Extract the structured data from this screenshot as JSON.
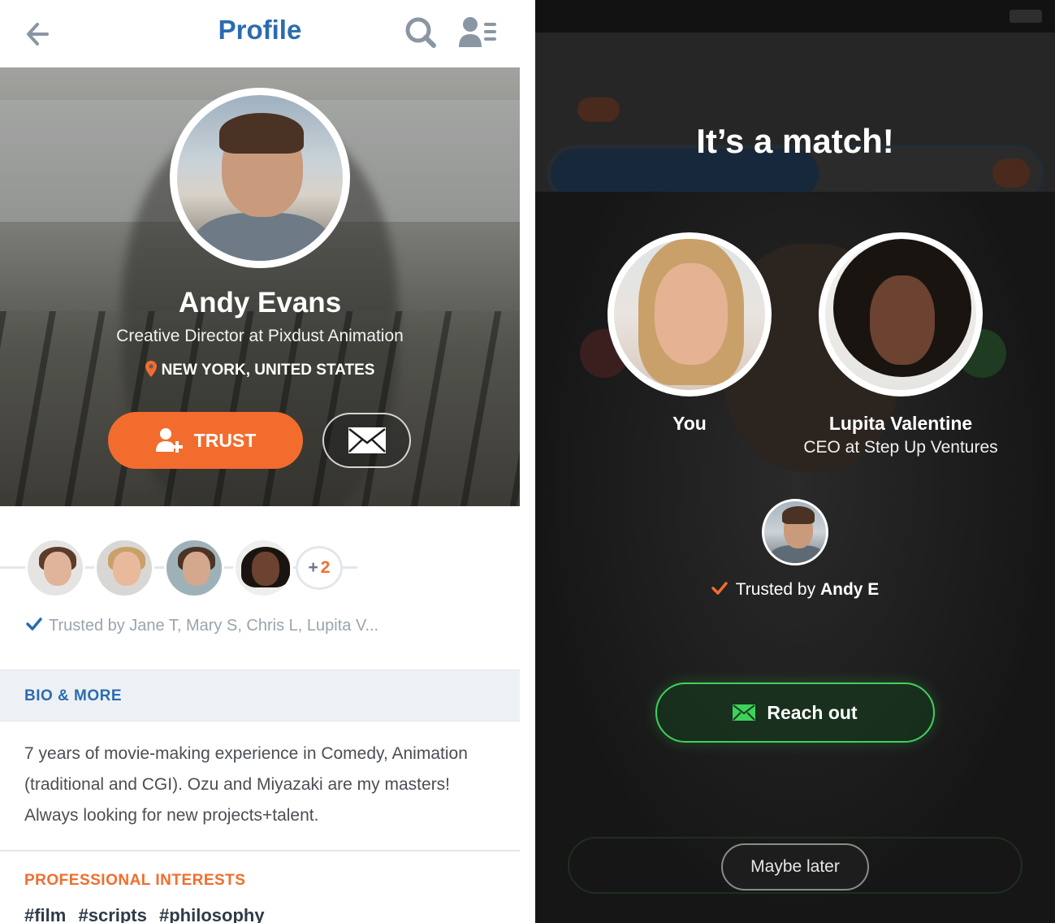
{
  "profile_screen": {
    "header": {
      "title": "Profile",
      "icons": [
        "back-arrow-icon",
        "search-icon",
        "contacts-list-icon"
      ]
    },
    "user": {
      "name": "Andy Evans",
      "role": "Creative Director at Pixdust Animation",
      "location": "NEW YORK, UNITED STATES"
    },
    "actions": {
      "trust_label": "TRUST",
      "message_icon": "envelope-icon"
    },
    "trusted": {
      "avatars": [
        "Jane T",
        "Mary S",
        "Chris L",
        "Lupita V"
      ],
      "more_count": "2",
      "more_prefix": "+",
      "text": "Trusted by Jane T, Mary S, Chris L, Lupita V..."
    },
    "bio": {
      "header": "BIO & MORE",
      "text": "7 years of movie-making experience in Comedy, Animation (traditional and CGI). Ozu and Miyazaki are my masters! Always looking for new projects+talent."
    },
    "interests": {
      "header": "PROFESSIONAL INTERESTS",
      "tags": [
        "#film",
        "#scripts",
        "#philosophy"
      ]
    }
  },
  "match_screen": {
    "title": "It’s a match!",
    "you_label": "You",
    "match": {
      "name": "Lupita Valentine",
      "role": "CEO at  Step Up Ventures"
    },
    "trusted_by_prefix": "Trusted by ",
    "trusted_by_name": "Andy E",
    "reach_out_label": "Reach out",
    "maybe_later_label": "Maybe later"
  },
  "colors": {
    "brand_blue": "#2b6cb0",
    "accent_orange": "#f26d2d",
    "accent_green": "#3fd15a",
    "dark_bg": "#1b1b1b"
  }
}
